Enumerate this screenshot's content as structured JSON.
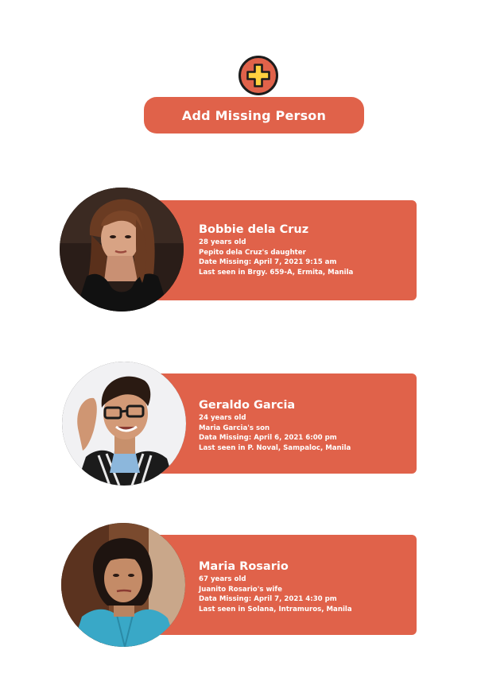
{
  "add_person": {
    "icon": "plus-icon",
    "label": "Add Missing Person",
    "icon_color": "#ffd13f",
    "button_color": "#e0624a"
  },
  "persons": [
    {
      "name": "Bobbie dela Cruz",
      "age": "28 years old",
      "relation": "Pepito dela Cruz's daughter",
      "date_missing": "Date Missing: April 7, 2021 9:15 am",
      "last_seen": "Last seen in Brgy. 659-A, Ermita, Manila"
    },
    {
      "name": "Geraldo Garcia",
      "age": "24 years old",
      "relation": "Maria Garcia's son",
      "date_missing": "Data Missing: April 6, 2021 6:00 pm",
      "last_seen": "Last seen in P. Noval, Sampaloc, Manila"
    },
    {
      "name": "Maria Rosario",
      "age": "67 years old",
      "relation": "Juanito Rosario's wife",
      "date_missing": "Data Missing: April 7, 2021 4:30 pm",
      "last_seen": "Last seen in Solana, Intramuros, Manila"
    }
  ]
}
